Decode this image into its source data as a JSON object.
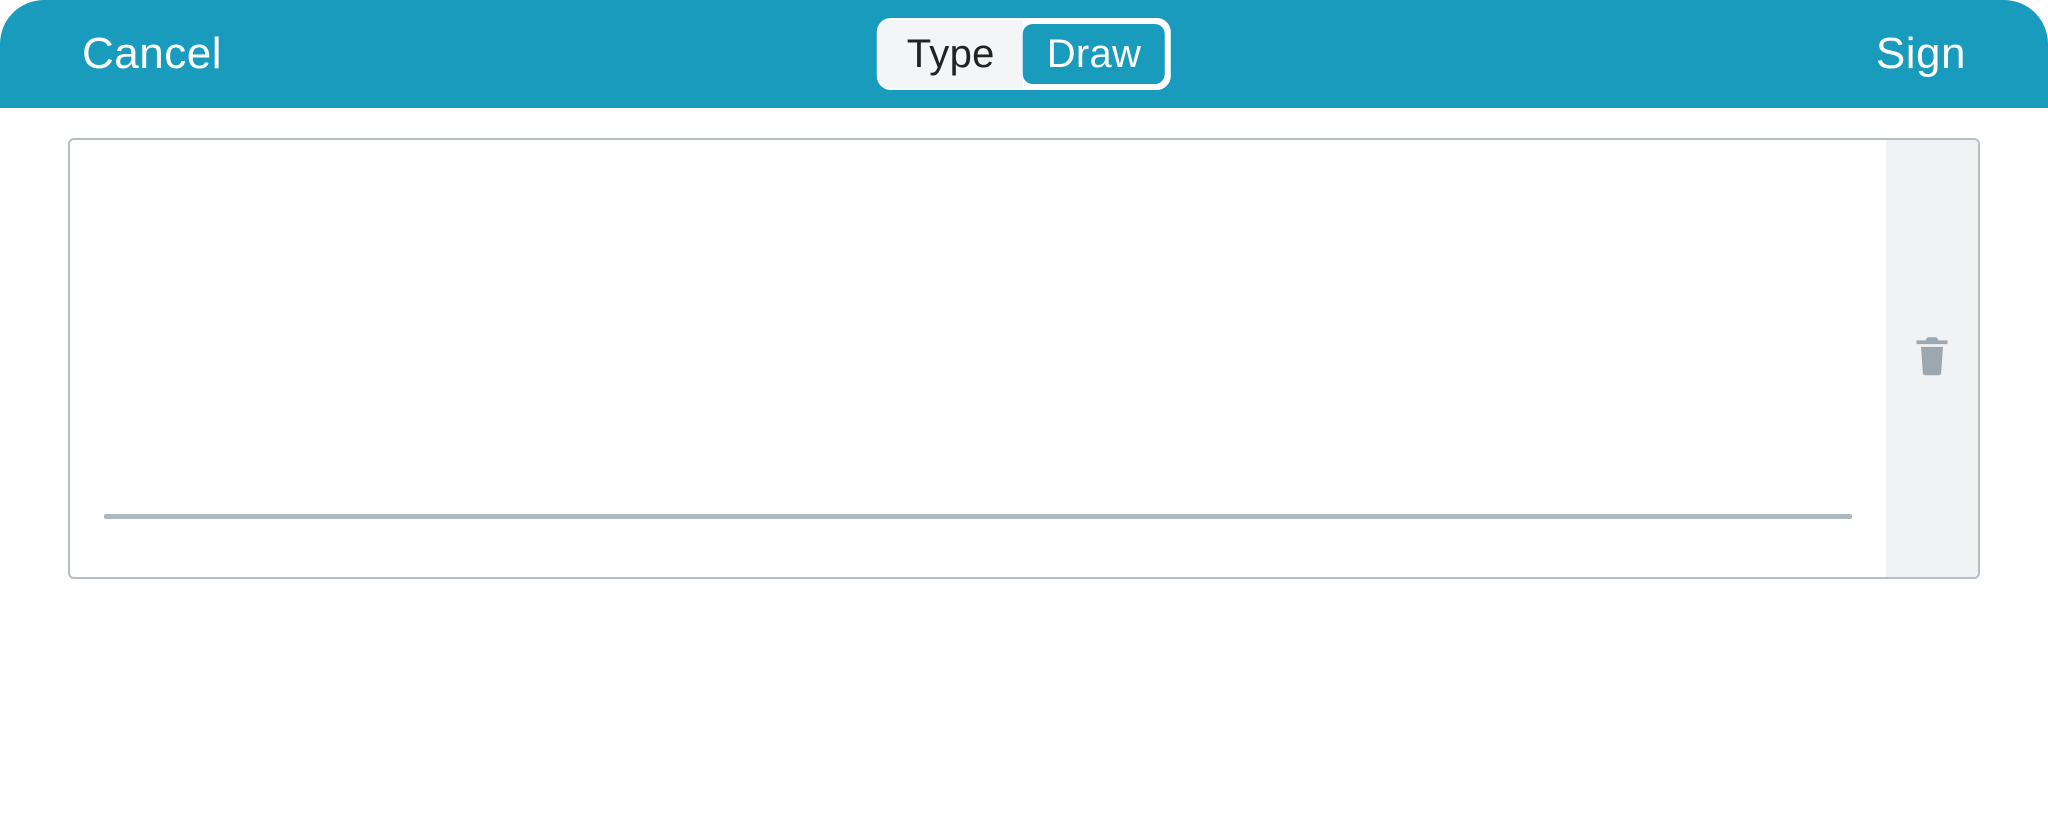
{
  "header": {
    "cancel_label": "Cancel",
    "sign_label": "Sign",
    "segments": {
      "type_label": "Type",
      "draw_label": "Draw"
    }
  },
  "colors": {
    "primary": "#189bbd",
    "border": "#b6bfc6",
    "line": "#aeb8c0",
    "panel": "#f0f2f4",
    "icon": "#9da7af"
  }
}
